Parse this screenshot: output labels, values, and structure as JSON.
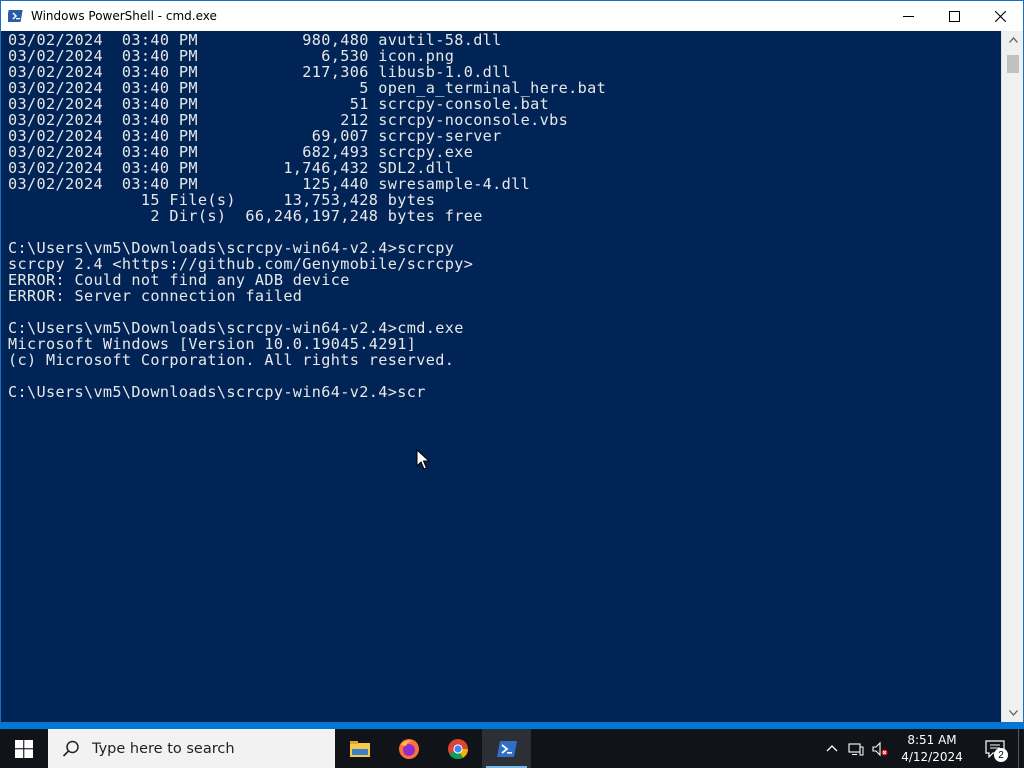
{
  "window": {
    "title": "Windows PowerShell - cmd.exe"
  },
  "console": {
    "lines": [
      "03/02/2024  03:40 PM           980,480 avutil-58.dll",
      "03/02/2024  03:40 PM             6,530 icon.png",
      "03/02/2024  03:40 PM           217,306 libusb-1.0.dll",
      "03/02/2024  03:40 PM                 5 open_a_terminal_here.bat",
      "03/02/2024  03:40 PM                51 scrcpy-console.bat",
      "03/02/2024  03:40 PM               212 scrcpy-noconsole.vbs",
      "03/02/2024  03:40 PM            69,007 scrcpy-server",
      "03/02/2024  03:40 PM           682,493 scrcpy.exe",
      "03/02/2024  03:40 PM         1,746,432 SDL2.dll",
      "03/02/2024  03:40 PM           125,440 swresample-4.dll",
      "              15 File(s)     13,753,428 bytes",
      "               2 Dir(s)  66,246,197,248 bytes free",
      "",
      "C:\\Users\\vm5\\Downloads\\scrcpy-win64-v2.4>scrcpy",
      "scrcpy 2.4 <https://github.com/Genymobile/scrcpy>",
      "ERROR: Could not find any ADB device",
      "ERROR: Server connection failed",
      "",
      "C:\\Users\\vm5\\Downloads\\scrcpy-win64-v2.4>cmd.exe",
      "Microsoft Windows [Version 10.0.19045.4291]",
      "(c) Microsoft Corporation. All rights reserved.",
      "",
      "C:\\Users\\vm5\\Downloads\\scrcpy-win64-v2.4>scr"
    ]
  },
  "taskbar": {
    "search_placeholder": "Type here to search",
    "clock_time": "8:51 AM",
    "clock_date": "4/12/2024",
    "notification_count": "2",
    "apps": [
      "file-explorer",
      "firefox",
      "chrome",
      "powershell"
    ]
  },
  "colors": {
    "console_bg": "#012456",
    "console_fg": "#e8e8e8",
    "taskbar_bg": "#101317",
    "desktop_bg": "#0078d7"
  }
}
